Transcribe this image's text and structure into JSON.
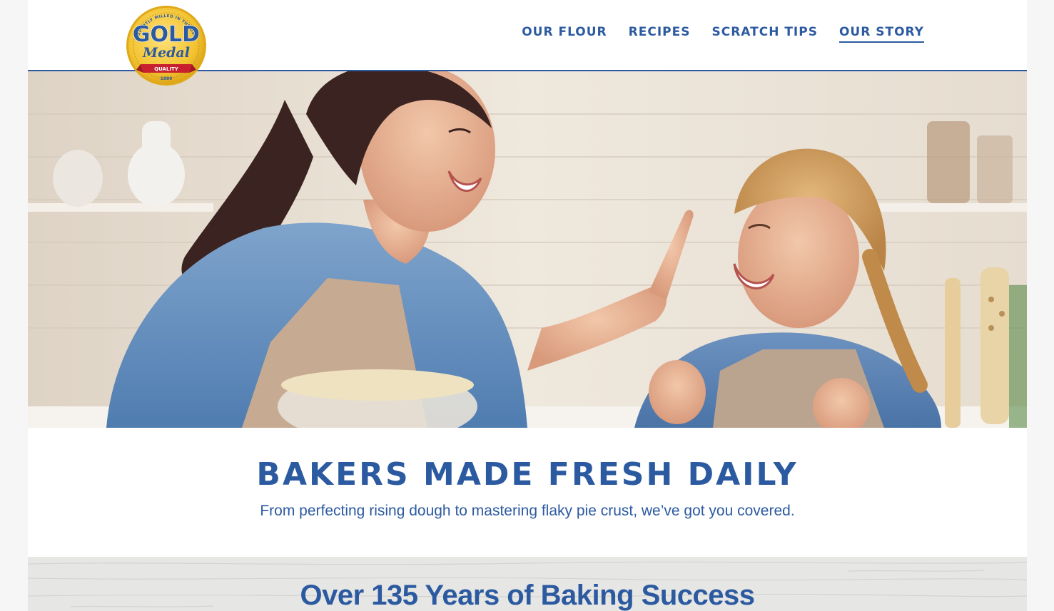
{
  "brand": {
    "logo_alt": "Gold Medal",
    "logo_word_top": "GOLD",
    "logo_word_script": "Medal",
    "logo_ribbon": "QUALITY",
    "logo_ring_text": "EXPERTLY MILLED IN THE USA",
    "logo_year": "1880",
    "colors": {
      "primary_blue": "#2c5aa0",
      "gold": "#f2c230",
      "red": "#c8202f"
    }
  },
  "nav": {
    "items": [
      {
        "label": "Our Flour",
        "active": false
      },
      {
        "label": "Recipes",
        "active": false
      },
      {
        "label": "Scratch Tips",
        "active": false
      },
      {
        "label": "Our Story",
        "active": true
      }
    ]
  },
  "hero": {
    "image_alt": "Mother and daughter laughing while baking together in a kitchen"
  },
  "intro": {
    "title": "Bakers Made Fresh Daily",
    "subtitle": "From perfecting rising dough to mastering flaky pie crust, we’ve got you covered."
  },
  "story": {
    "heading": "Over 135 Years of Baking Success"
  }
}
